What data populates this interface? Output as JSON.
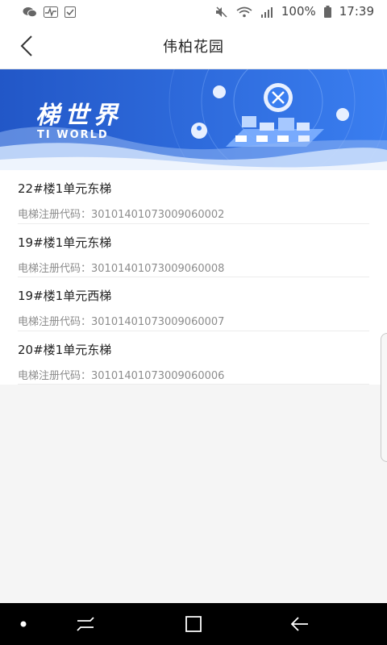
{
  "status_bar": {
    "left_icons": [
      "wechat-icon",
      "pulse-icon",
      "checkbox-icon"
    ],
    "right_icons": [
      "mute-icon",
      "wifi-icon",
      "signal-icon",
      "battery-icon"
    ],
    "battery": "100%",
    "time": "17:39"
  },
  "header": {
    "title": "伟柏花园"
  },
  "banner": {
    "title": "梯世界",
    "subtitle": "TI WORLD"
  },
  "list": {
    "items": [
      {
        "name": "22#楼1单元东梯",
        "code_label": "电梯注册代码：",
        "code": "30101401073009060002"
      },
      {
        "name": "19#楼1单元东梯",
        "code_label": "电梯注册代码：",
        "code": "30101401073009060008"
      },
      {
        "name": "19#楼1单元西梯",
        "code_label": "电梯注册代码：",
        "code": "30101401073009060007"
      },
      {
        "name": "20#楼1单元东梯",
        "code_label": "电梯注册代码：",
        "code": "30101401073009060006"
      }
    ]
  },
  "nav_bar": {
    "buttons": [
      "dot-icon",
      "recent-apps-icon",
      "home-icon",
      "back-arrow-icon"
    ]
  }
}
